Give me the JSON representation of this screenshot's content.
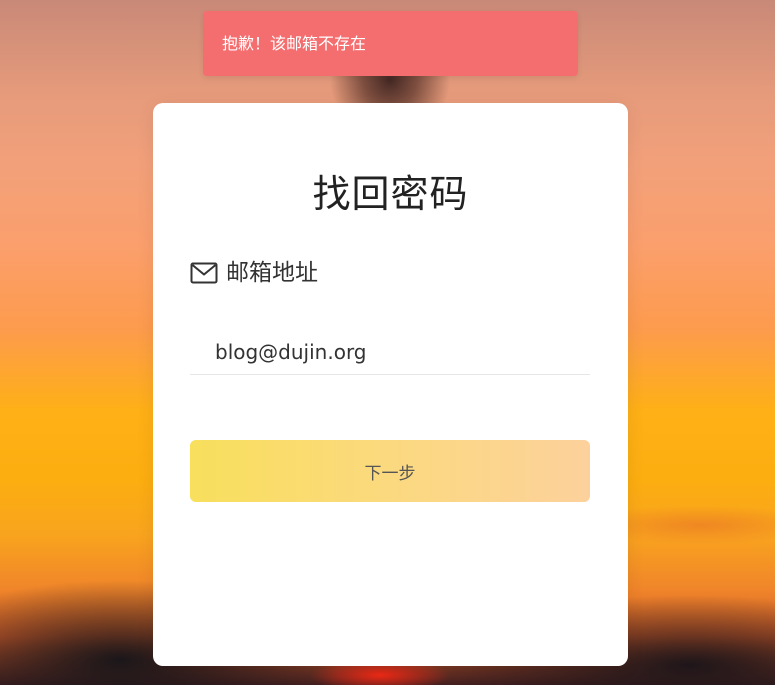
{
  "toast": {
    "message": "抱歉！该邮箱不存在",
    "color": "#f46e70"
  },
  "card": {
    "title": "找回密码",
    "email_field": {
      "icon": "mail-icon",
      "label": "邮箱地址",
      "value": "blog@dujin.org"
    },
    "next_button": {
      "label": "下一步"
    }
  },
  "colors": {
    "button_gradient_start": "#f8df5c",
    "button_gradient_end": "#fdd19c",
    "card_background": "#ffffff"
  }
}
